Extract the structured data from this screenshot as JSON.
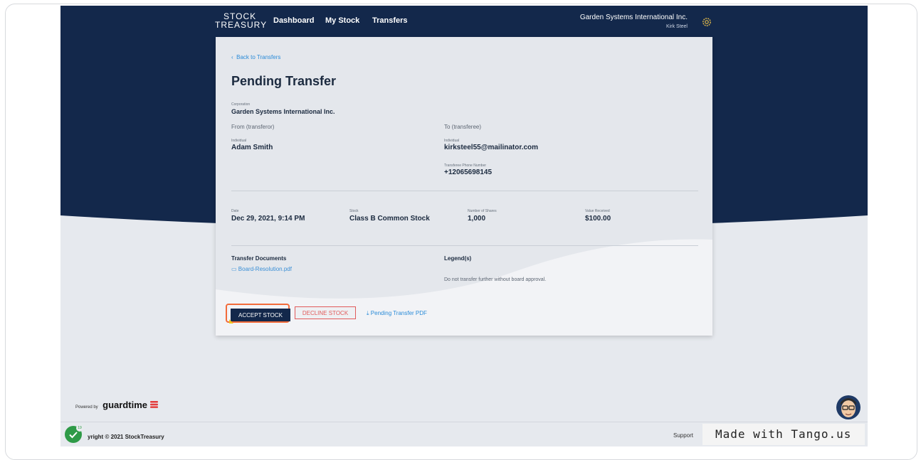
{
  "header": {
    "logo_line1": "STOCK",
    "logo_line2": "TREASURY",
    "nav": [
      "Dashboard",
      "My Stock",
      "Transfers"
    ],
    "org_name": "Garden Systems International Inc.",
    "user_name": "Kirk Steel"
  },
  "transfer": {
    "back_link": "Back to Transfers",
    "title": "Pending Transfer",
    "corporation_label": "Corporation",
    "corporation": "Garden Systems International Inc.",
    "from_heading": "From (transferor)",
    "to_heading": "To (transferee)",
    "from_type": "Individual",
    "from_name": "Adam Smith",
    "to_type": "Individual",
    "to_email": "kirksteel55@mailinator.com",
    "phone_label": "Transferee Phone Number",
    "phone": "+12065698145",
    "date_label": "Date",
    "date": "Dec 29, 2021, 9:14 PM",
    "stock_label": "Stock",
    "stock": "Class B Common Stock",
    "shares_label": "Number of Shares",
    "shares": "1,000",
    "value_label": "Value Received",
    "value": "$100.00",
    "documents_heading": "Transfer Documents",
    "document": "Board-Resolution.pdf",
    "legends_heading": "Legend(s)",
    "legend_text": "Do not transfer further without board approval.",
    "accept_label": "ACCEPT STOCK",
    "decline_label": "DECLINE STOCK",
    "pdf_label": "Pending Transfer PDF"
  },
  "footer": {
    "powered_by": "Powered by",
    "brand": "guardtime",
    "copyright": "yright © 2021 StockTreasury",
    "support": "Support"
  },
  "overlay": {
    "badge_count": "19",
    "made_with": "Made with Tango.us"
  },
  "colors": {
    "navy": "#13284b",
    "accent_orange": "#f26b3a",
    "link_blue": "#2a8bd8",
    "decline_red": "#e15b5b",
    "tango_green": "#2e9a47"
  }
}
